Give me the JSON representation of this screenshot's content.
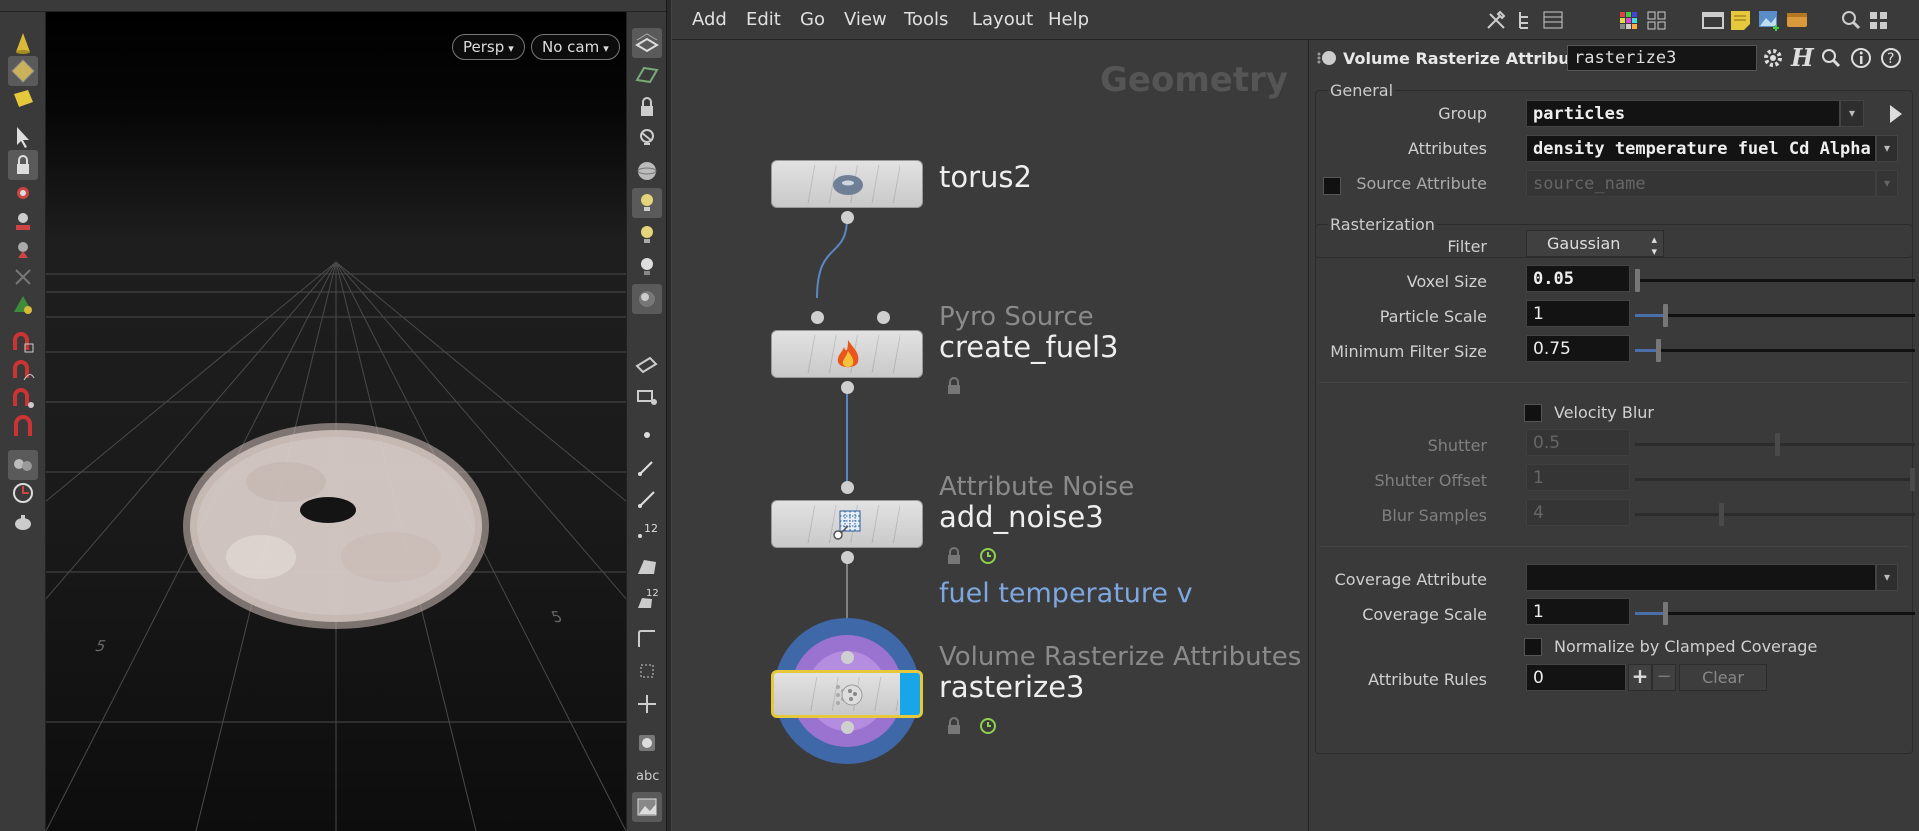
{
  "viewport": {
    "persp_label": "Persp",
    "camera_label": "No cam",
    "ground_labels": [
      "5",
      "5"
    ]
  },
  "menubar": {
    "items": [
      "Add",
      "Edit",
      "Go",
      "View",
      "Tools",
      "Layout",
      "Help"
    ]
  },
  "network": {
    "context_label": "Geometry",
    "nodes": [
      {
        "type": "",
        "name": "torus2"
      },
      {
        "type": "Pyro Source",
        "name": "create_fuel3"
      },
      {
        "type": "Attribute Noise",
        "name": "add_noise3"
      },
      {
        "type": "Volume Rasterize Attributes",
        "name": "rasterize3"
      }
    ],
    "comment": "fuel temperature v"
  },
  "params": {
    "title": "Volume Rasterize Attribu...",
    "node_name": "rasterize3",
    "general": {
      "label": "General",
      "group_label": "Group",
      "group_value": "particles",
      "attributes_label": "Attributes",
      "attributes_value": "density temperature fuel Cd Alpha",
      "source_attr_label": "Source Attribute",
      "source_attr_placeholder": "source_name"
    },
    "rasterization": {
      "label": "Rasterization",
      "filter_label": "Filter",
      "filter_value": "Gaussian",
      "voxel_size_label": "Voxel Size",
      "voxel_size_value": "0.05",
      "voxel_size_slider": 0.0,
      "particle_scale_label": "Particle Scale",
      "particle_scale_value": "1",
      "particle_scale_slider": 0.1,
      "min_filter_label": "Minimum Filter Size",
      "min_filter_value": "0.75",
      "min_filter_slider": 0.075,
      "velocity_blur_label": "Velocity Blur",
      "shutter_label": "Shutter",
      "shutter_value": "0.5",
      "shutter_slider": 0.5,
      "shutter_offset_label": "Shutter Offset",
      "shutter_offset_value": "1",
      "shutter_offset_slider": 1.0,
      "blur_samples_label": "Blur Samples",
      "blur_samples_value": "4",
      "blur_samples_slider": 0.3,
      "coverage_attr_label": "Coverage Attribute",
      "coverage_attr_value": "",
      "coverage_scale_label": "Coverage Scale",
      "coverage_scale_value": "1",
      "coverage_scale_slider": 0.1,
      "normalize_label": "Normalize by Clamped Coverage",
      "attribute_rules_label": "Attribute Rules",
      "attribute_rules_value": "0",
      "plus_label": "+",
      "minus_label": "−",
      "clear_label": "Clear"
    }
  },
  "colors": {
    "selected_border": "#e6c83c",
    "comment_text": "#7ea7e0",
    "wire": "#5b86c4",
    "slider_fill": "#4a6fa8"
  }
}
